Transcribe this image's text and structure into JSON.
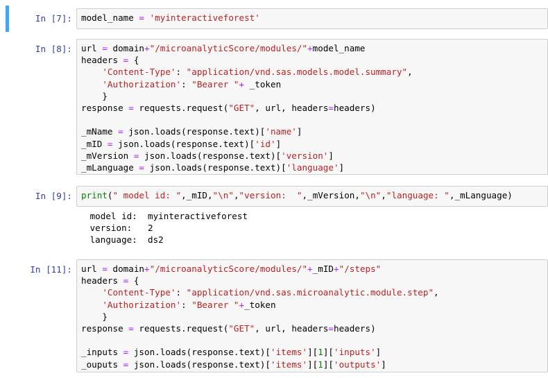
{
  "cells": [
    {
      "prompt": "In [7]:",
      "lines": [
        [
          [
            "t",
            "model_name "
          ],
          [
            "o",
            "="
          ],
          [
            "t",
            " "
          ],
          [
            "s",
            "'myinteractiveforest'"
          ]
        ]
      ]
    },
    {
      "prompt": "In [8]:",
      "lines": [
        [
          [
            "t",
            "url "
          ],
          [
            "o",
            "="
          ],
          [
            "t",
            " domain"
          ],
          [
            "o",
            "+"
          ],
          [
            "s",
            "\"/microanalyticScore/modules/\""
          ],
          [
            "o",
            "+"
          ],
          [
            "t",
            "model_name"
          ]
        ],
        [
          [
            "t",
            "headers "
          ],
          [
            "o",
            "="
          ],
          [
            "t",
            " {"
          ]
        ],
        [
          [
            "t",
            "    "
          ],
          [
            "s",
            "'Content-Type'"
          ],
          [
            "t",
            ": "
          ],
          [
            "s",
            "\"application/vnd.sas.models.model.summary\""
          ],
          [
            "t",
            ","
          ]
        ],
        [
          [
            "t",
            "    "
          ],
          [
            "s",
            "'Authorization'"
          ],
          [
            "t",
            ": "
          ],
          [
            "s",
            "\"Bearer \""
          ],
          [
            "o",
            "+"
          ],
          [
            "t",
            " _token"
          ]
        ],
        [
          [
            "t",
            "    }"
          ]
        ],
        [
          [
            "t",
            "response "
          ],
          [
            "o",
            "="
          ],
          [
            "t",
            " requests.request("
          ],
          [
            "s",
            "\"GET\""
          ],
          [
            "t",
            ", url, headers"
          ],
          [
            "o",
            "="
          ],
          [
            "t",
            "headers)"
          ]
        ],
        [
          [
            "t",
            ""
          ]
        ],
        [
          [
            "t",
            "_mName "
          ],
          [
            "o",
            "="
          ],
          [
            "t",
            " json.loads(response.text)["
          ],
          [
            "s",
            "'name'"
          ],
          [
            "t",
            "]"
          ]
        ],
        [
          [
            "t",
            "_mID "
          ],
          [
            "o",
            "="
          ],
          [
            "t",
            " json.loads(response.text)["
          ],
          [
            "s",
            "'id'"
          ],
          [
            "t",
            "]"
          ]
        ],
        [
          [
            "t",
            "_mVersion "
          ],
          [
            "o",
            "="
          ],
          [
            "t",
            " json.loads(response.text)["
          ],
          [
            "s",
            "'version'"
          ],
          [
            "t",
            "]"
          ]
        ],
        [
          [
            "t",
            "_mLanguage "
          ],
          [
            "o",
            "="
          ],
          [
            "t",
            " json.loads(response.text)["
          ],
          [
            "s",
            "'language'"
          ],
          [
            "t",
            "]"
          ]
        ]
      ]
    },
    {
      "prompt": "In [9]:",
      "lines": [
        [
          [
            "k",
            "print"
          ],
          [
            "t",
            "("
          ],
          [
            "s",
            "\" model id: \""
          ],
          [
            "t",
            ",_mID,"
          ],
          [
            "s",
            "\"\\n\""
          ],
          [
            "t",
            ","
          ],
          [
            "s",
            "\"version:  \""
          ],
          [
            "t",
            ",_mVersion,"
          ],
          [
            "s",
            "\"\\n\""
          ],
          [
            "t",
            ","
          ],
          [
            "s",
            "\"language: \""
          ],
          [
            "t",
            ",_mLanguage)"
          ]
        ]
      ],
      "output": [
        " model id:  myinteractiveforest",
        " version:   2",
        " language:  ds2"
      ]
    },
    {
      "prompt": "In [11]:",
      "lines": [
        [
          [
            "t",
            "url "
          ],
          [
            "o",
            "="
          ],
          [
            "t",
            " domain"
          ],
          [
            "o",
            "+"
          ],
          [
            "s",
            "\"/microanalyticScore/modules/\""
          ],
          [
            "o",
            "+"
          ],
          [
            "t",
            "_mID"
          ],
          [
            "o",
            "+"
          ],
          [
            "s",
            "\"/steps\""
          ]
        ],
        [
          [
            "t",
            "headers "
          ],
          [
            "o",
            "="
          ],
          [
            "t",
            " {"
          ]
        ],
        [
          [
            "t",
            "    "
          ],
          [
            "s",
            "'Content-Type'"
          ],
          [
            "t",
            ": "
          ],
          [
            "s",
            "\"application/vnd.sas.microanalytic.module.step\""
          ],
          [
            "t",
            ","
          ]
        ],
        [
          [
            "t",
            "    "
          ],
          [
            "s",
            "'Authorization'"
          ],
          [
            "t",
            ": "
          ],
          [
            "s",
            "\"Bearer \""
          ],
          [
            "o",
            "+"
          ],
          [
            "t",
            "_token"
          ]
        ],
        [
          [
            "t",
            "    }"
          ]
        ],
        [
          [
            "t",
            "response "
          ],
          [
            "o",
            "="
          ],
          [
            "t",
            " requests.request("
          ],
          [
            "s",
            "\"GET\""
          ],
          [
            "t",
            ", url, headers"
          ],
          [
            "o",
            "="
          ],
          [
            "t",
            "headers)"
          ]
        ],
        [
          [
            "t",
            ""
          ]
        ],
        [
          [
            "t",
            "_inputs "
          ],
          [
            "o",
            "="
          ],
          [
            "t",
            " json.loads(response.text)["
          ],
          [
            "s",
            "'items'"
          ],
          [
            "t",
            "]["
          ],
          [
            "k",
            "1"
          ],
          [
            "t",
            "]["
          ],
          [
            "s",
            "'inputs'"
          ],
          [
            "t",
            "]"
          ]
        ],
        [
          [
            "t",
            "_ouputs "
          ],
          [
            "o",
            "="
          ],
          [
            "t",
            " json.loads(response.text)["
          ],
          [
            "s",
            "'items'"
          ],
          [
            "t",
            "]["
          ],
          [
            "k",
            "1"
          ],
          [
            "t",
            "]["
          ],
          [
            "s",
            "'outputs'"
          ],
          [
            "t",
            "]"
          ]
        ]
      ]
    }
  ]
}
